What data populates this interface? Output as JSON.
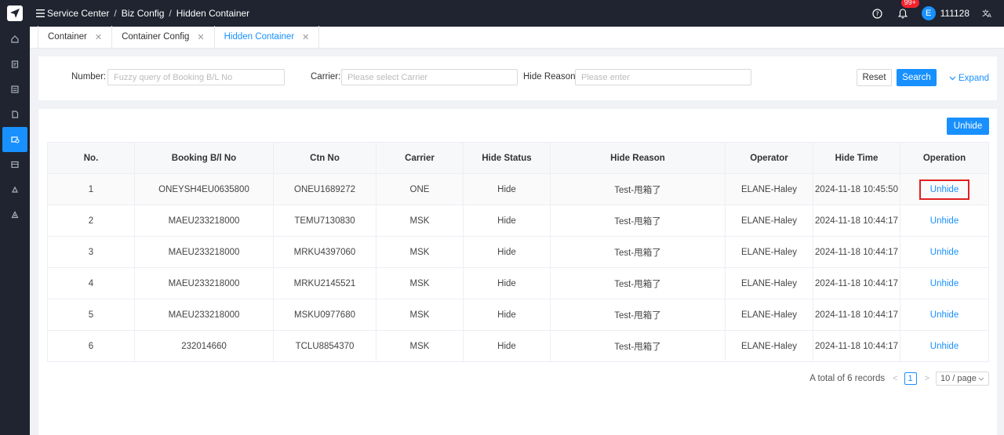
{
  "breadcrumb": [
    "Service Center",
    "Biz Config",
    "Hidden Container"
  ],
  "header": {
    "notification_count": "99+",
    "avatar_letter": "E",
    "username": "111128"
  },
  "tabs": [
    {
      "label": "Container"
    },
    {
      "label": "Container Config"
    },
    {
      "label": "Hidden Container"
    }
  ],
  "filters": {
    "number_label": "Number:",
    "number_placeholder": "Fuzzy query of Booking B/L No",
    "carrier_label": "Carrier:",
    "carrier_placeholder": "Please select Carrier",
    "reason_label": "Hide Reason:",
    "reason_placeholder": "Please enter",
    "reset_label": "Reset",
    "search_label": "Search",
    "expand_label": "Expand"
  },
  "table": {
    "unhide_button": "Unhide",
    "columns": [
      "No.",
      "Booking B/l No",
      "Ctn No",
      "Carrier",
      "Hide Status",
      "Hide Reason",
      "Operator",
      "Hide Time",
      "Operation"
    ],
    "rows": [
      {
        "no": "1",
        "booking": "ONEYSH4EU0635800",
        "ctn": "ONEU1689272",
        "carrier": "ONE",
        "status": "Hide",
        "reason": "Test-甩箱了",
        "operator": "ELANE-Haley",
        "time": "2024-11-18 10:45:50",
        "op": "Unhide"
      },
      {
        "no": "2",
        "booking": "MAEU233218000",
        "ctn": "TEMU7130830",
        "carrier": "MSK",
        "status": "Hide",
        "reason": "Test-甩箱了",
        "operator": "ELANE-Haley",
        "time": "2024-11-18 10:44:17",
        "op": "Unhide"
      },
      {
        "no": "3",
        "booking": "MAEU233218000",
        "ctn": "MRKU4397060",
        "carrier": "MSK",
        "status": "Hide",
        "reason": "Test-甩箱了",
        "operator": "ELANE-Haley",
        "time": "2024-11-18 10:44:17",
        "op": "Unhide"
      },
      {
        "no": "4",
        "booking": "MAEU233218000",
        "ctn": "MRKU2145521",
        "carrier": "MSK",
        "status": "Hide",
        "reason": "Test-甩箱了",
        "operator": "ELANE-Haley",
        "time": "2024-11-18 10:44:17",
        "op": "Unhide"
      },
      {
        "no": "5",
        "booking": "MAEU233218000",
        "ctn": "MSKU0977680",
        "carrier": "MSK",
        "status": "Hide",
        "reason": "Test-甩箱了",
        "operator": "ELANE-Haley",
        "time": "2024-11-18 10:44:17",
        "op": "Unhide"
      },
      {
        "no": "6",
        "booking": "232014660",
        "ctn": "TCLU8854370",
        "carrier": "MSK",
        "status": "Hide",
        "reason": "Test-甩箱了",
        "operator": "ELANE-Haley",
        "time": "2024-11-18 10:44:17",
        "op": "Unhide"
      }
    ]
  },
  "pagination": {
    "total_text": "A total of 6 records",
    "current_page": "1",
    "page_size": "10 / page"
  },
  "colors": {
    "accent": "#1890ff",
    "nav_bg": "#1f2430",
    "highlight": "#e02020"
  }
}
